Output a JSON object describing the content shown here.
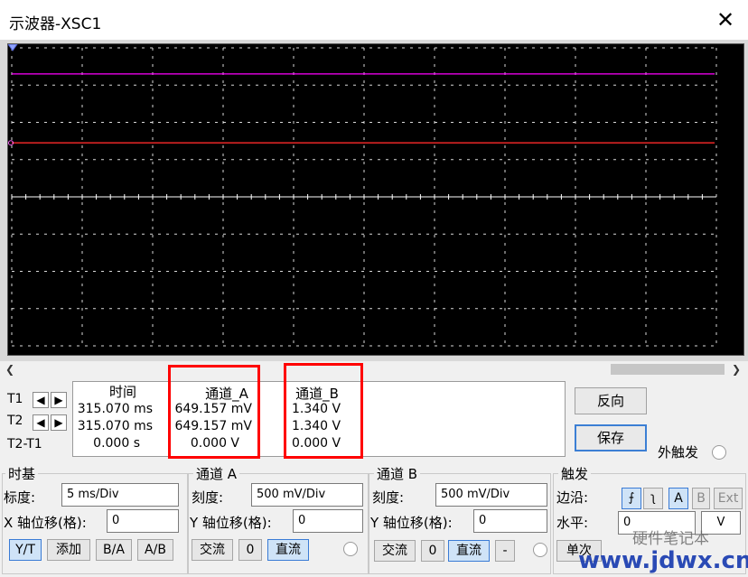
{
  "window": {
    "title": "示波器-XSC1",
    "close_icon": "close-icon"
  },
  "screen": {
    "background": "#000000",
    "trace_a_color": "#ff00ff",
    "trace_b_color": "#ff2a2a",
    "grid_color": "#ffffff"
  },
  "cursors": {
    "t1": "T1",
    "t2": "T2",
    "t2_t1": "T2-T1",
    "headers": {
      "time": "时间",
      "channel_a": "通道_A",
      "channel_b": "通道_B"
    },
    "rows": [
      {
        "time": "315.070 ms",
        "a": "649.157 mV",
        "b": "1.340 V"
      },
      {
        "time": "315.070 ms",
        "a": "649.157 mV",
        "b": "1.340 V"
      },
      {
        "time": "0.000 s",
        "a": "0.000 V",
        "b": "0.000 V"
      }
    ]
  },
  "buttons": {
    "reverse": "反向",
    "save": "保存",
    "ext_trigger": "外触发"
  },
  "timebase": {
    "title": "时基",
    "scale_label": "标度:",
    "scale_value": "5 ms/Div",
    "x_pos_label": "X 轴位移(格):",
    "x_pos_value": "0",
    "modes": [
      "Y/T",
      "添加",
      "B/A",
      "A/B"
    ]
  },
  "channel_a": {
    "title": "通道 A",
    "scale_label": "刻度:",
    "scale_value": "500 mV/Div",
    "y_pos_label": "Y 轴位移(格):",
    "y_pos_value": "0",
    "coupling": [
      "交流",
      "0",
      "直流"
    ]
  },
  "channel_b": {
    "title": "通道 B",
    "scale_label": "刻度:",
    "scale_value": "500 mV/Div",
    "y_pos_label": "Y 轴位移(格):",
    "y_pos_value": "0",
    "coupling": [
      "交流",
      "0",
      "直流",
      "-"
    ]
  },
  "trigger": {
    "title": "触发",
    "edge_label": "边沿:",
    "level_label": "水平:",
    "level_value": "0",
    "level_unit": "V",
    "sources": [
      "A",
      "B",
      "Ext"
    ],
    "single": "单次"
  },
  "watermark": {
    "url": "www.jdwx.cn",
    "cn": "硬件笔记本"
  }
}
